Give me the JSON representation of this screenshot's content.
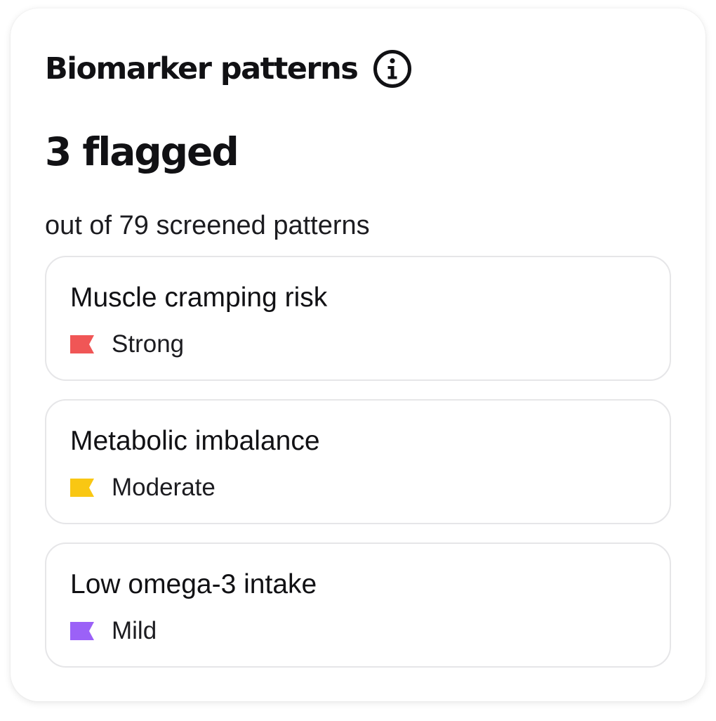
{
  "card": {
    "title": "Biomarker patterns",
    "info_icon": "info-circle-icon",
    "flagged_count": "3 flagged",
    "subtitle": "out of 79 screened patterns"
  },
  "patterns": [
    {
      "name": "Muscle cramping risk",
      "severity": "Strong",
      "flag_icon": "flag-icon",
      "color": "#F05656"
    },
    {
      "name": "Metabolic imbalance",
      "severity": "Moderate",
      "flag_icon": "flag-icon",
      "color": "#F9C713"
    },
    {
      "name": "Low omega-3 intake",
      "severity": "Mild",
      "flag_icon": "flag-icon",
      "color": "#9B61F7"
    }
  ]
}
